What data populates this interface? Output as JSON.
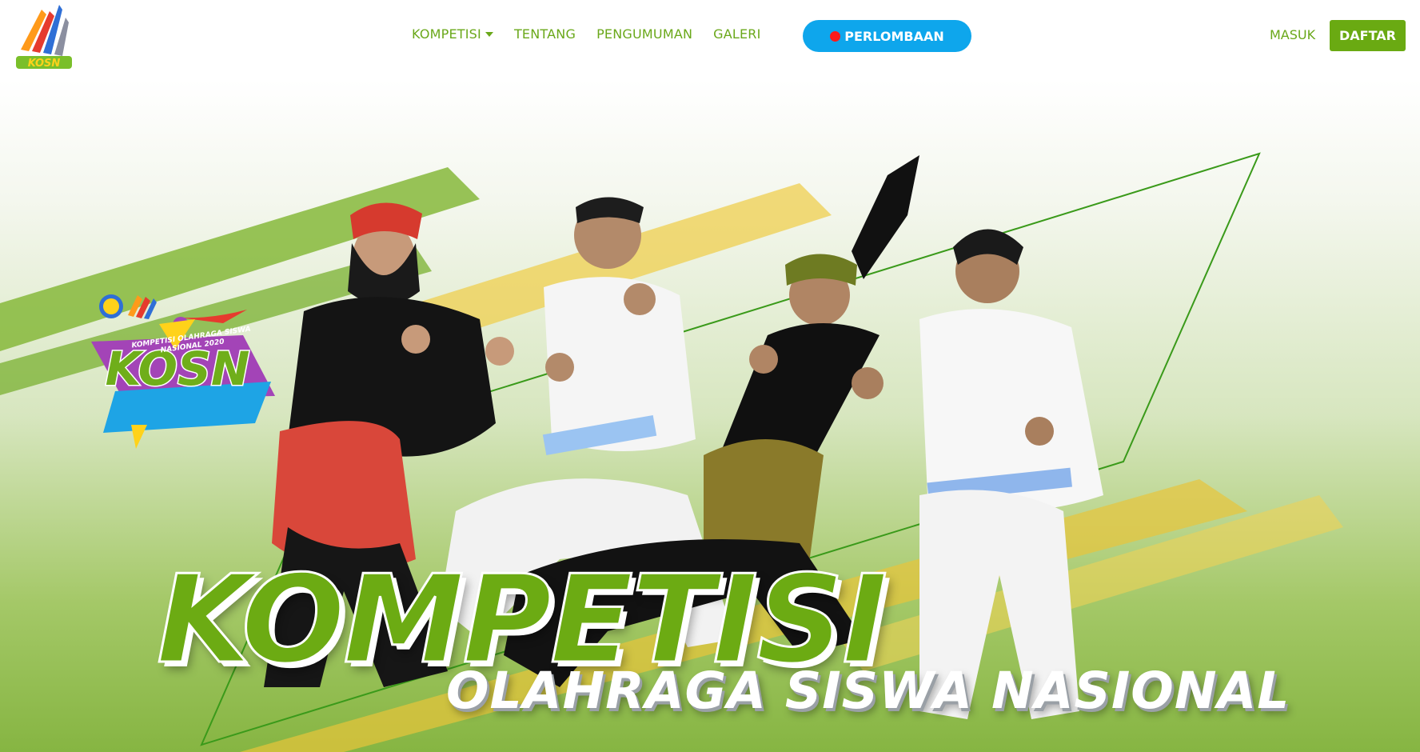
{
  "navbar": {
    "logo_text": "KOSN",
    "links": [
      {
        "label": "KOMPETISI",
        "dropdown": true
      },
      {
        "label": "TENTANG"
      },
      {
        "label": "PENGUMUMAN"
      },
      {
        "label": "GALERI"
      }
    ],
    "live_button": {
      "label": "PERLOMBAAN",
      "icon": "live-dot-icon",
      "color": "#0ea6ec"
    },
    "login_label": "MASUK",
    "register_label": "DAFTAR"
  },
  "hero": {
    "title": "KOMPETISI",
    "subtitle": "OLAHRAGA SISWA NASIONAL",
    "event_logo": {
      "wordmark": "KOSN",
      "caption": "KOMPETISI OLAHRAGA SISWA NASIONAL 2020"
    }
  },
  "colors": {
    "brand_green": "#6aa81a",
    "button_green": "#6aaa12",
    "accent_blue": "#0ea6ec",
    "live_red": "#ff1a1a"
  }
}
